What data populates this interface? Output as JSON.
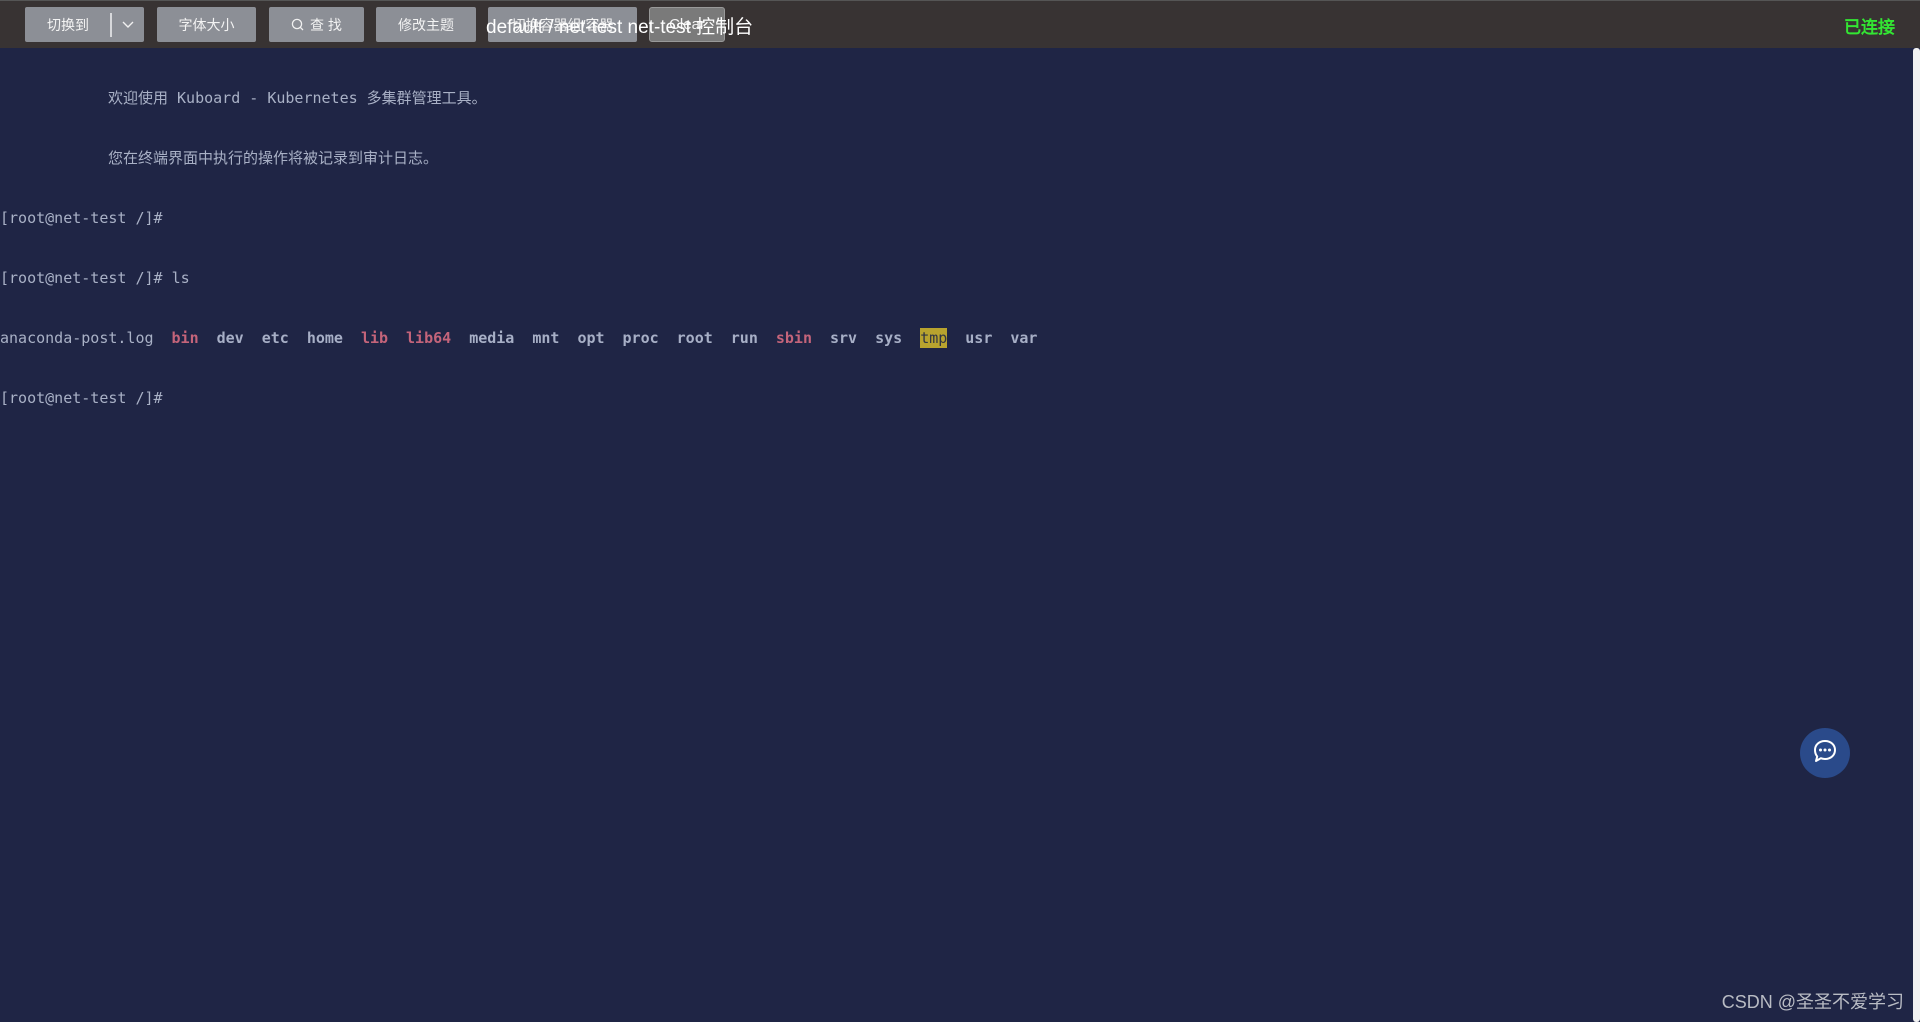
{
  "toolbar": {
    "switch_to_label": "切换到",
    "font_size_label": "字体大小",
    "find_label": "查 找",
    "theme_label": "修改主题",
    "switch_container_label": "切换容器组/容器",
    "clear_label": "Clear"
  },
  "header": {
    "title": "default / net-test net-test 控制台",
    "status": "已连接",
    "status_color": "#33e633"
  },
  "terminal": {
    "welcome_line_1": "欢迎使用 Kuboard - Kubernetes 多集群管理工具。",
    "welcome_line_2": "您在终端界面中执行的操作将被记录到审计日志。",
    "prompt_1": "[root@net-test /]#",
    "prompt_2": "[root@net-test /]# ls",
    "ls_output": [
      {
        "name": "anaconda-post.log",
        "type": "file"
      },
      {
        "name": "bin",
        "type": "link"
      },
      {
        "name": "dev",
        "type": "dir"
      },
      {
        "name": "etc",
        "type": "dir"
      },
      {
        "name": "home",
        "type": "dir"
      },
      {
        "name": "lib",
        "type": "link"
      },
      {
        "name": "lib64",
        "type": "link"
      },
      {
        "name": "media",
        "type": "dir"
      },
      {
        "name": "mnt",
        "type": "dir"
      },
      {
        "name": "opt",
        "type": "dir"
      },
      {
        "name": "proc",
        "type": "dir"
      },
      {
        "name": "root",
        "type": "dir"
      },
      {
        "name": "run",
        "type": "dir"
      },
      {
        "name": "sbin",
        "type": "link"
      },
      {
        "name": "srv",
        "type": "dir"
      },
      {
        "name": "sys",
        "type": "dir"
      },
      {
        "name": "tmp",
        "type": "sticky"
      },
      {
        "name": "usr",
        "type": "dir"
      },
      {
        "name": "var",
        "type": "dir"
      }
    ],
    "prompt_3": "[root@net-test /]#"
  },
  "chat_button": {
    "icon": "chat-bubble-icon"
  },
  "watermark": "CSDN @圣圣不爱学习"
}
